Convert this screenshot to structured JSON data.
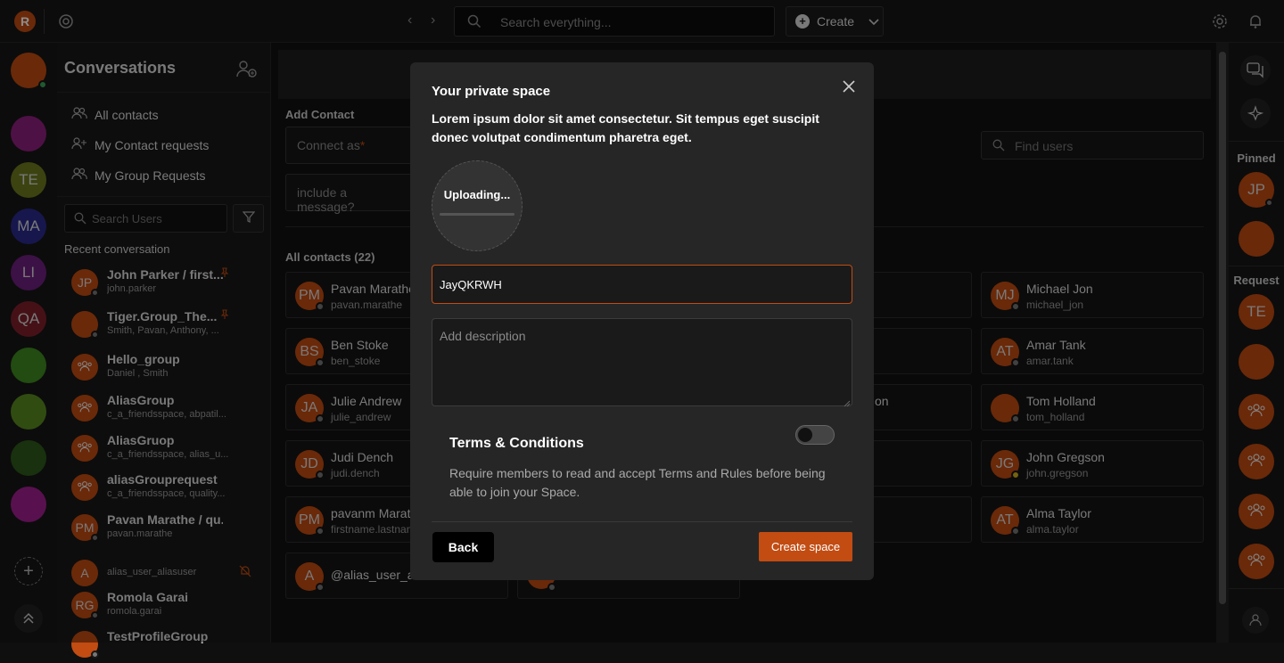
{
  "app": {
    "logo_letter": "R"
  },
  "search": {
    "placeholder": "Search everything..."
  },
  "create": {
    "label": "Create"
  },
  "rail": {
    "avatars": [
      {
        "initials": "",
        "color": "#c24c12"
      },
      {
        "initials": "",
        "color": "#8e1f7e"
      },
      {
        "initials": "TE",
        "color": "#6e7a1f"
      },
      {
        "initials": "MA",
        "color": "#2a2a8e"
      },
      {
        "initials": "LI",
        "color": "#6e1f7e"
      },
      {
        "initials": "QA",
        "color": "#7e1f2a"
      },
      {
        "initials": "",
        "color": "#3e8a1f"
      },
      {
        "initials": "",
        "color": "#5a8a1f"
      },
      {
        "initials": "",
        "color": "#2e5a1a"
      },
      {
        "initials": "",
        "color": "#a01f8e"
      }
    ]
  },
  "sidebar": {
    "title": "Conversations",
    "nav": [
      {
        "label": "All contacts"
      },
      {
        "label": "My Contact requests"
      },
      {
        "label": "My Group Requests"
      }
    ],
    "search_placeholder": "Search Users",
    "recent_title": "Recent conversation",
    "conversations": [
      {
        "initials": "JP",
        "name": "John Parker / first...",
        "sub": "john.parker",
        "pinned": true
      },
      {
        "initials": "",
        "name": "Tiger.Group_The...",
        "sub": "Smith, Pavan, Anthony, ...",
        "pinned": true
      },
      {
        "initials": "group",
        "name": "Hello_group",
        "sub": "Daniel , Smith",
        "pinned": false
      },
      {
        "initials": "group",
        "name": "AliasGroup",
        "sub": "c_a_friendsspace, abpatil...",
        "pinned": false
      },
      {
        "initials": "group",
        "name": "AliasGruop",
        "sub": "c_a_friendsspace, alias_u...",
        "pinned": false
      },
      {
        "initials": "group",
        "name": "aliasGrouprequest",
        "sub": "c_a_friendsspace, quality...",
        "pinned": false
      },
      {
        "initials": "PM",
        "name": "Pavan Marathe / qu...",
        "sub": "pavan.marathe",
        "pinned": false
      },
      {
        "initials": "A",
        "name": "",
        "sub": "alias_user_aliasuser",
        "pinned": false
      },
      {
        "initials": "RG",
        "name": "Romola Garai",
        "sub": "romola.garai",
        "pinned": false
      },
      {
        "initials": "",
        "name": "TestProfileGroup",
        "sub": "",
        "pinned": false
      }
    ]
  },
  "main": {
    "add_contact": "Add Contact",
    "connect_as": "Connect as",
    "required_mark": "*",
    "message_placeholder": "include a message?",
    "find_users": "Find users",
    "all_contacts": "All contacts (22)",
    "contacts": [
      {
        "initials": "PM",
        "name": "Pavan Marathe",
        "sub": "pavan.marathe",
        "col": 0,
        "row": 0
      },
      {
        "initials": "BS",
        "name": "Ben Stoke",
        "sub": "ben_stoke",
        "col": 0,
        "row": 1
      },
      {
        "initials": "JA",
        "name": "Julie Andrew",
        "sub": "julie_andrew",
        "col": 0,
        "row": 2
      },
      {
        "initials": "JD",
        "name": "Judi Dench",
        "sub": "judi.dench",
        "col": 0,
        "row": 3
      },
      {
        "initials": "PM",
        "name": "pavanm Marat",
        "sub": "firstname.lastnam",
        "col": 0,
        "row": 4
      },
      {
        "initials": "A",
        "name": "@alias_user_al",
        "sub": "",
        "col": 0,
        "row": 5
      },
      {
        "initials": "MJ",
        "name": "Michael Jon",
        "sub": "michael_jon",
        "col": 3,
        "row": 0
      },
      {
        "initials": "AT",
        "name": "Amar Tank",
        "sub": "amar.tank",
        "col": 3,
        "row": 1
      },
      {
        "initials": "",
        "name": "Tom Holland",
        "sub": "tom_holland",
        "col": 3,
        "row": 2
      },
      {
        "initials": "JG",
        "name": "John Gregson",
        "sub": "john.gregson",
        "col": 3,
        "row": 3
      },
      {
        "initials": "AT",
        "name": "Alma Taylor",
        "sub": "alma.taylor",
        "col": 3,
        "row": 4
      }
    ],
    "partial_text": "on"
  },
  "right_rail": {
    "pinned_title": "Pinned",
    "request_title": "Request",
    "pinned": [
      "JP",
      ""
    ],
    "requests": [
      "TE",
      "",
      "group",
      "group",
      "group",
      "group"
    ]
  },
  "modal": {
    "title": "Your private space",
    "description": "Lorem ipsum dolor sit amet consectetur. Sit tempus eget suscipit donec volutpat condimentum pharetra eget.",
    "uploading_text": "Uploading...",
    "upload_progress": 0.0,
    "name_value": "JayQKRWH",
    "description_placeholder": "Add description",
    "terms_title": "Terms & Conditions",
    "terms_desc": "Require members to read and accept Terms and Rules before being able to join your Space.",
    "terms_enabled": false,
    "back_label": "Back",
    "create_label": "Create space"
  },
  "colors": {
    "accent": "#c24c12",
    "bg": "#0f0f0f"
  }
}
